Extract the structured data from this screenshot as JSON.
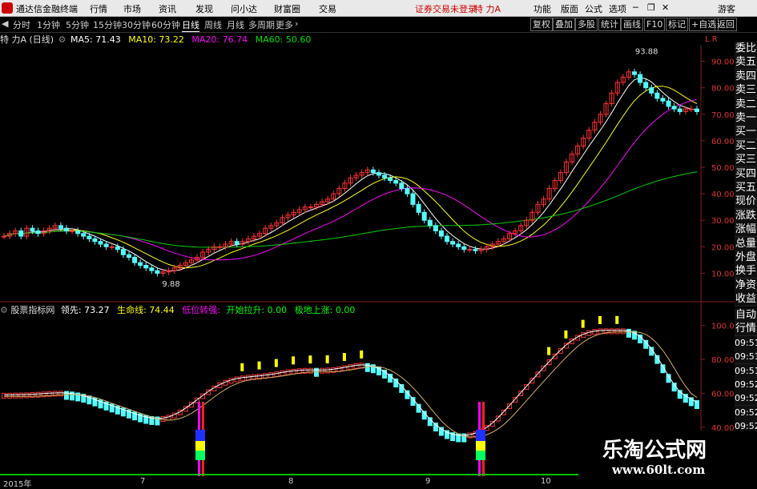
{
  "app": {
    "title": "通达信金融终端",
    "menus": [
      "行情",
      "市场",
      "资讯",
      "发现",
      "问小达",
      "财富圈",
      "交易"
    ],
    "status": "证券交易未登录",
    "stock_name": "特 力A",
    "right_menus": [
      "功能",
      "版面",
      "公式",
      "选项"
    ],
    "guest": "游客"
  },
  "toolbar": {
    "periods": [
      "分时",
      "1分钟",
      "5分钟",
      "15分钟",
      "30分钟",
      "60分钟",
      "日线",
      "周线",
      "月线",
      "多周期",
      "更多"
    ],
    "active_period": "日线",
    "right_buttons": [
      "复权",
      "叠加",
      "多股",
      "统计",
      "画线",
      "F10",
      "标记",
      "+自选",
      "返回"
    ]
  },
  "main_chart": {
    "title": "特 力A (日线)",
    "ma": [
      {
        "label": "MA5: 71.43",
        "color": "#ffffff"
      },
      {
        "label": "MA10: 73.22",
        "color": "#ffff00"
      },
      {
        "label": "MA20: 76.74",
        "color": "#ff00ff"
      },
      {
        "label": "MA60: 50.60",
        "color": "#00e000"
      }
    ],
    "y_ticks": [
      "90.00",
      "80.00",
      "70.00",
      "60.00",
      "50.00",
      "40.00",
      "30.00",
      "20.00",
      "10.00"
    ],
    "high_label": "93.88",
    "low_label": "9.88",
    "corner": "L R"
  },
  "indicator": {
    "name": "股票指标网",
    "fields": [
      {
        "label": "领先: 73.27",
        "color": "#ffffff"
      },
      {
        "label": "生命线: 74.44",
        "color": "#ffff00"
      },
      {
        "label": "低位转强: ",
        "color": "#ff00ff"
      },
      {
        "label": "开始拉升: 0.00",
        "color": "#00ff00"
      },
      {
        "label": "极地上涨: 0.00",
        "color": "#00ff00"
      }
    ],
    "y_ticks": [
      "100.0",
      "80.00",
      "60.00",
      "40.00"
    ]
  },
  "dates": [
    "2015年",
    "7",
    "8",
    "9",
    "10"
  ],
  "side_panel": {
    "order": [
      "委比",
      "卖五",
      "卖四",
      "卖三",
      "卖二",
      "卖一",
      "买一",
      "买二",
      "买三",
      "买四",
      "买五",
      "现价",
      "涨跌",
      "涨幅",
      "总量",
      "外盘",
      "换手",
      "净资",
      "收益"
    ],
    "detail": [
      "自动",
      "行情",
      "09:51",
      "09:51",
      "09:51",
      "09:52",
      "09:52",
      "09:52",
      "09:52"
    ]
  },
  "watermark": {
    "name": "乐淘公式网",
    "url": "www.60lt.com"
  },
  "colors": {
    "up": "#ff3232",
    "down": "#54ffff",
    "ma5": "#ffffff",
    "ma10": "#ffff00",
    "ma20": "#ff00ff",
    "ma60": "#00d000"
  },
  "chart_data": [
    {
      "type": "candlestick",
      "title": "特 力A (日线)",
      "ylim": [
        5,
        95
      ],
      "x_labels": [
        "2015年",
        "7",
        "8",
        "9",
        "10"
      ],
      "closes": [
        24,
        25,
        26,
        24,
        27,
        26,
        25,
        26,
        27,
        28,
        27,
        26,
        26,
        25,
        24,
        23,
        22,
        21,
        20,
        20,
        19,
        17,
        16,
        14,
        13,
        12,
        11,
        10,
        10.5,
        11,
        12,
        13,
        14,
        15,
        16,
        18,
        19,
        20,
        20,
        21,
        22,
        21,
        22,
        23,
        24,
        25,
        27,
        28,
        29,
        31,
        32,
        33,
        34,
        35,
        35,
        36,
        37,
        38,
        40,
        42,
        44,
        46,
        47,
        48,
        49,
        48,
        47,
        46,
        45,
        44,
        42,
        40,
        36,
        33,
        30,
        28,
        26,
        24,
        22,
        21,
        20,
        19,
        19,
        18.5,
        19,
        20,
        21,
        22,
        23,
        25,
        26,
        28,
        30,
        33,
        36,
        38,
        42,
        45,
        48,
        52,
        55,
        58,
        61,
        64,
        67,
        70,
        74,
        78,
        82,
        84,
        86,
        85,
        82,
        80,
        78,
        76,
        75,
        73,
        72,
        71,
        72,
        72,
        71
      ],
      "ma": [
        "MA5",
        "MA10",
        "MA20",
        "MA60"
      ]
    },
    {
      "type": "bar",
      "title": "股票指标网",
      "ylim": [
        30,
        105
      ],
      "series": [
        {
          "name": "领先",
          "last": 73.27
        },
        {
          "name": "生命线",
          "last": 74.44
        }
      ]
    }
  ]
}
